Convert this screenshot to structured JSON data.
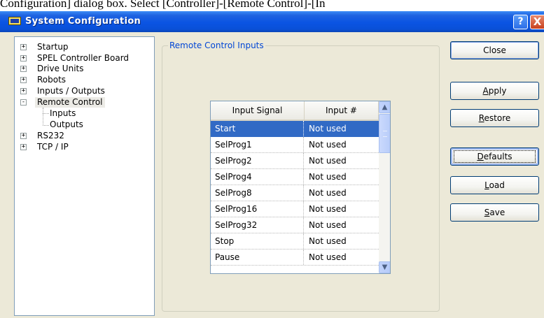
{
  "doc_text": "Configuration] dialog box.  Select [Controller]-[Remote Control]-[In",
  "window": {
    "title": "System Configuration",
    "help_button": "?",
    "close_glyph": "X",
    "app_icon": "window-app-icon"
  },
  "tree": {
    "items": [
      {
        "label": "Startup",
        "expander": "+"
      },
      {
        "label": "SPEL Controller Board",
        "expander": "+"
      },
      {
        "label": "Drive Units",
        "expander": "+"
      },
      {
        "label": "Robots",
        "expander": "+"
      },
      {
        "label": "Inputs / Outputs",
        "expander": "+"
      },
      {
        "label": "Remote Control",
        "expander": "-",
        "selected": true
      },
      {
        "label": "Inputs",
        "child": true
      },
      {
        "label": "Outputs",
        "child": true
      },
      {
        "label": "RS232",
        "expander": "+"
      },
      {
        "label": "TCP / IP",
        "expander": "+"
      }
    ]
  },
  "group": {
    "title": "Remote Control Inputs"
  },
  "grid": {
    "headers": [
      "Input Signal",
      "Input #"
    ],
    "rows": [
      {
        "signal": "Start",
        "input": "Not used",
        "selected": true
      },
      {
        "signal": "SelProg1",
        "input": "Not used"
      },
      {
        "signal": "SelProg2",
        "input": "Not used"
      },
      {
        "signal": "SelProg4",
        "input": "Not used"
      },
      {
        "signal": "SelProg8",
        "input": "Not used"
      },
      {
        "signal": "SelProg16",
        "input": "Not used"
      },
      {
        "signal": "SelProg32",
        "input": "Not used"
      },
      {
        "signal": "Stop",
        "input": "Not used"
      },
      {
        "signal": "Pause",
        "input": "Not used"
      }
    ],
    "scroll_up_glyph": "▲",
    "scroll_down_glyph": "▼"
  },
  "buttons": {
    "close": "Close",
    "apply": {
      "mnemonic": "A",
      "rest": "pply"
    },
    "restore": {
      "mnemonic": "R",
      "rest": "estore"
    },
    "defaults": {
      "mnemonic": "D",
      "rest": "efaults"
    },
    "load": {
      "mnemonic": "L",
      "rest": "oad"
    },
    "save": {
      "mnemonic": "S",
      "rest": "ave"
    }
  },
  "colors": {
    "title_bar": "#0a54e3",
    "selection": "#316ac5",
    "group_title": "#0046d5",
    "dialog_bg": "#ece9d8"
  }
}
